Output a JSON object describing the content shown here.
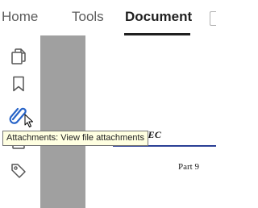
{
  "tabs": {
    "home": "Home",
    "tools": "Tools",
    "document": "Document"
  },
  "sidebar": {
    "icons": [
      "pages-icon",
      "bookmark-icon",
      "attachment-icon",
      "signature-icon",
      "tag-icon"
    ],
    "active_icon": "attachment-icon"
  },
  "tooltip": {
    "text": "Attachments: View file attachments"
  },
  "document": {
    "heading": "T TEC",
    "subtext": "Part 9"
  },
  "colors": {
    "accent": "#2864c8",
    "rule": "#2b3f95",
    "gutter": "#a0a0a0",
    "tooltip_bg": "#ffffe1"
  }
}
